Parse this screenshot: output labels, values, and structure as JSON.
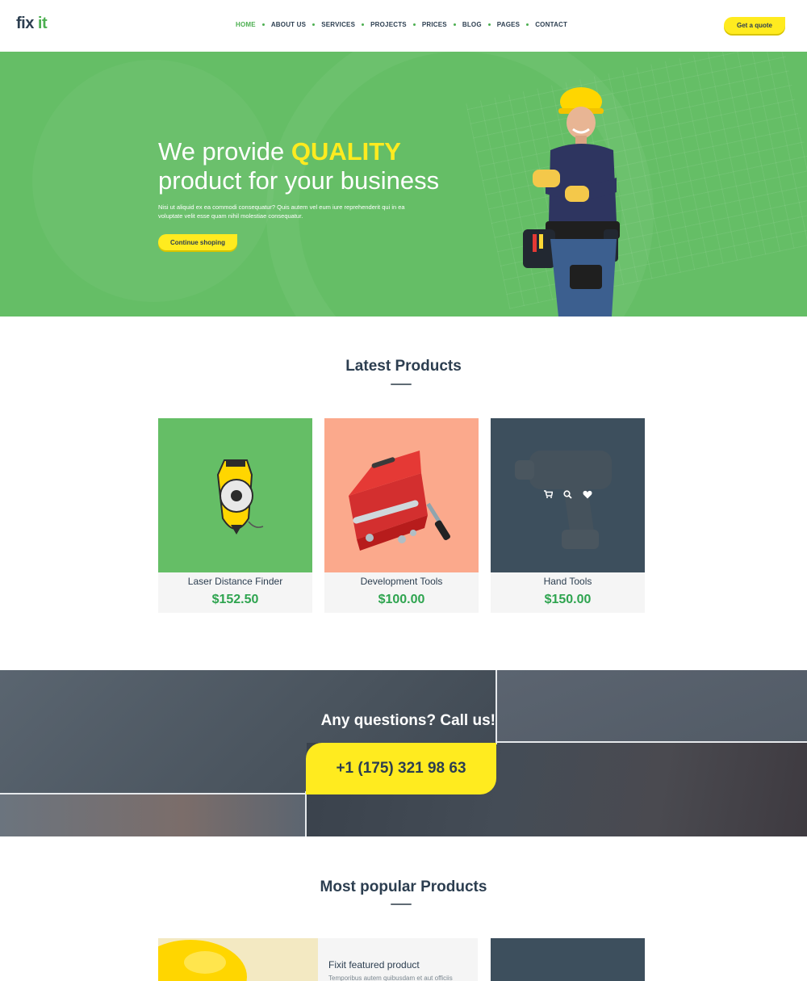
{
  "header": {
    "logo_main": "fix ",
    "logo_accent": "it",
    "nav": [
      {
        "label": "HOME",
        "active": true
      },
      {
        "label": "ABOUT US",
        "active": false
      },
      {
        "label": "SERVICES",
        "active": false
      },
      {
        "label": "PROJECTS",
        "active": false
      },
      {
        "label": "PRICES",
        "active": false
      },
      {
        "label": "BLOG",
        "active": false
      },
      {
        "label": "PAGES",
        "active": false
      },
      {
        "label": "CONTACT",
        "active": false
      }
    ],
    "quote_button": "Get a quote"
  },
  "hero": {
    "title_pre": "We provide ",
    "title_highlight": "QUALITY",
    "title_line2": "product for your business",
    "text": "Nisi ut aliquid ex ea commodi consequatur? Quis autem vel eum iure reprehenderit qui in ea voluptate velit esse quam nihil molestiae consequatur.",
    "button": "Continue shoping"
  },
  "latest": {
    "title": "Latest Products",
    "products": [
      {
        "name": "Laser Distance Finder",
        "price": "$152.50",
        "bg": "#65be66",
        "image": "tape-measure"
      },
      {
        "name": "Development Tools",
        "price": "$100.00",
        "bg": "#fba98c",
        "image": "toolbox"
      },
      {
        "name": "Hand Tools",
        "price": "$150.00",
        "bg": "#3d4f5d",
        "image": "impact-drill"
      }
    ],
    "overlay_icons": [
      "cart-icon",
      "search-icon",
      "heart-icon"
    ]
  },
  "call": {
    "heading": "Any questions? Call us!",
    "phone": "+1 (175) 321 98 63"
  },
  "popular": {
    "title": "Most popular Products",
    "featured_title": "Fixit featured product",
    "featured_sub": "Temporibus autem quibusdam et aut officiis"
  },
  "colors": {
    "brand_green": "#65be66",
    "accent_yellow": "#ffeb1f",
    "price_green": "#2ea44f",
    "dark_slate": "#2c3e50"
  }
}
